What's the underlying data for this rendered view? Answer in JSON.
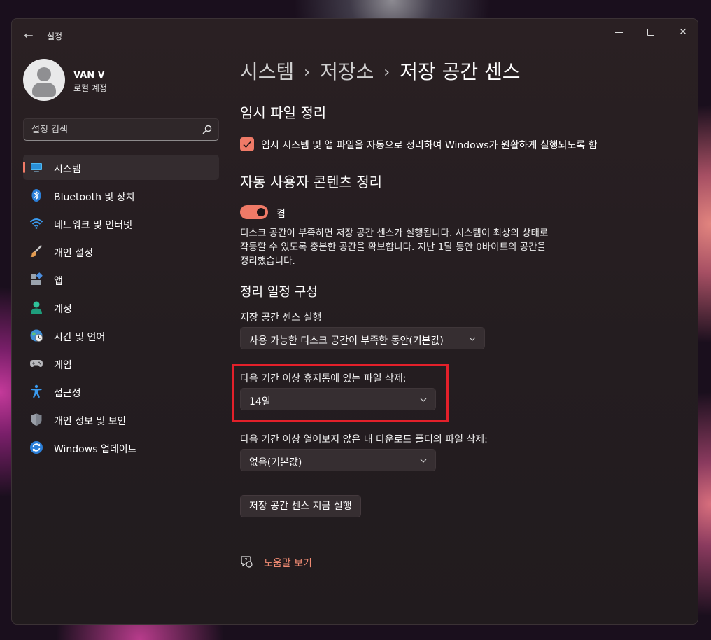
{
  "window": {
    "title": "설정"
  },
  "user": {
    "name": "VAN V",
    "account_type": "로컬 계정"
  },
  "search": {
    "placeholder": "설정 검색"
  },
  "sidebar": {
    "items": [
      {
        "label": "시스템",
        "icon": "system-icon",
        "active": true
      },
      {
        "label": "Bluetooth 및 장치",
        "icon": "bluetooth-icon"
      },
      {
        "label": "네트워크 및 인터넷",
        "icon": "wifi-icon"
      },
      {
        "label": "개인 설정",
        "icon": "brush-icon"
      },
      {
        "label": "앱",
        "icon": "apps-icon"
      },
      {
        "label": "계정",
        "icon": "account-icon"
      },
      {
        "label": "시간 및 언어",
        "icon": "time-language-icon"
      },
      {
        "label": "게임",
        "icon": "gamepad-icon"
      },
      {
        "label": "접근성",
        "icon": "accessibility-icon"
      },
      {
        "label": "개인 정보 및 보안",
        "icon": "shield-icon"
      },
      {
        "label": "Windows 업데이트",
        "icon": "update-icon"
      }
    ]
  },
  "breadcrumb": {
    "level1": "시스템",
    "level2": "저장소",
    "current": "저장 공간 센스",
    "separator": "›"
  },
  "temp_files": {
    "title": "임시 파일 정리",
    "checkbox_label": "임시 시스템 및 앱 파일을 자동으로 정리하여 Windows가 원활하게 실행되도록 함",
    "checked": true
  },
  "auto_cleanup": {
    "title": "자동 사용자 콘텐츠 정리",
    "toggle_state": "켬",
    "description": "디스크 공간이 부족하면 저장 공간 센스가 실행됩니다. 시스템이 최상의 상태로 작동할 수 있도록 충분한 공간을 확보합니다. 지난 1달 동안 0바이트의 공간을 정리했습니다."
  },
  "schedule": {
    "title": "정리 일정 구성",
    "run_label": "저장 공간 센스 실행",
    "run_value": "사용 가능한 디스크 공간이 부족한 동안(기본값)",
    "recycle_label": "다음 기간 이상 휴지통에 있는 파일 삭제:",
    "recycle_value": "14일",
    "downloads_label": "다음 기간 이상 열어보지 않은 내 다운로드 폴더의 파일 삭제:",
    "downloads_value": "없음(기본값)"
  },
  "actions": {
    "run_now": "저장 공간 센스 지금 실행",
    "help": "도움말 보기"
  },
  "colors": {
    "accent": "#ef7a67",
    "highlight_box": "#e3202a"
  }
}
